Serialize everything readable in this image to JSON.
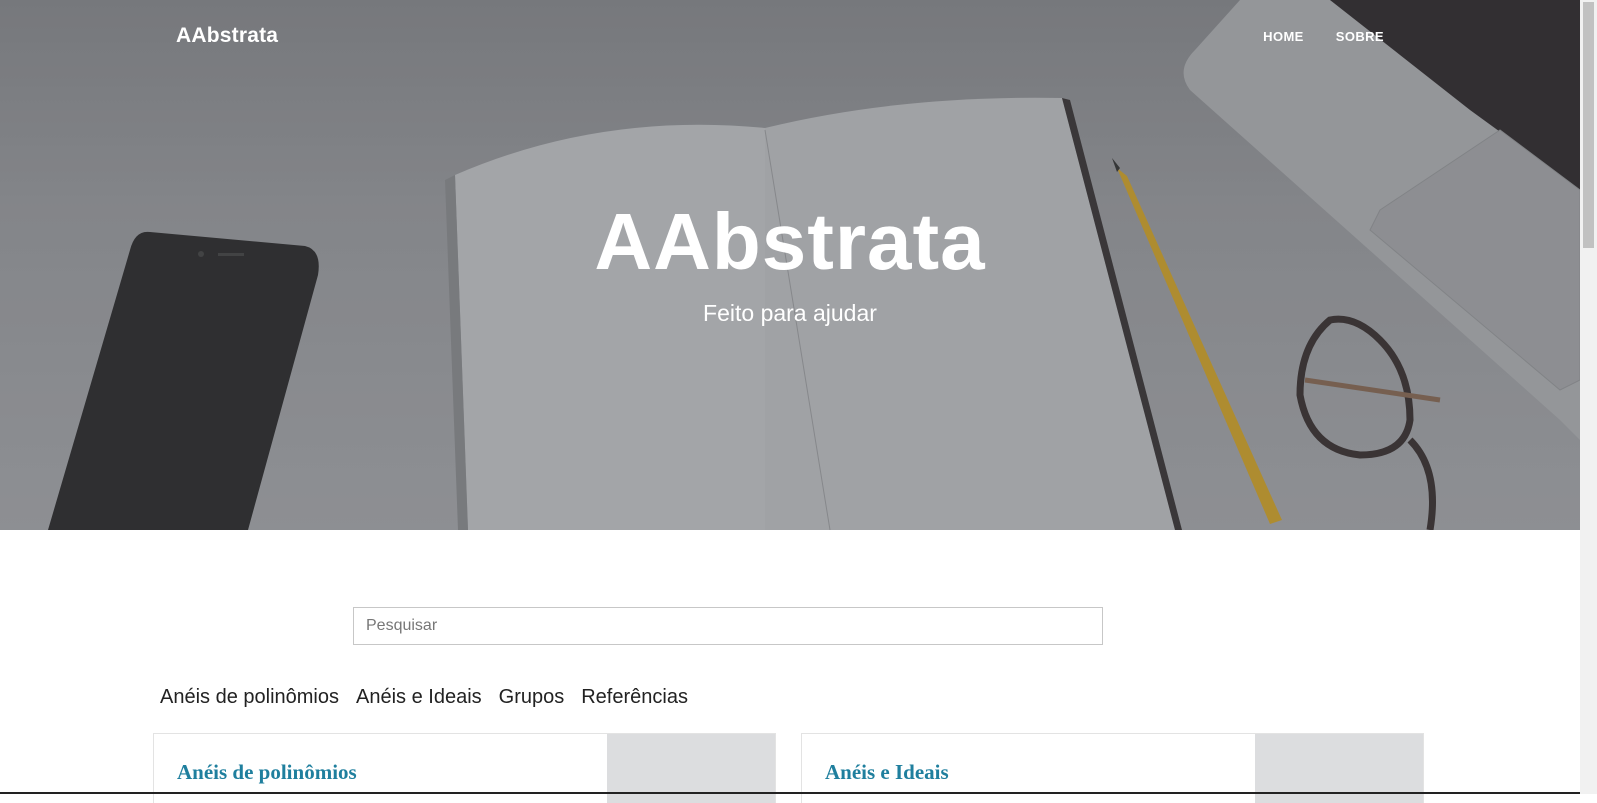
{
  "header": {
    "brand": "AAbstrata",
    "nav": [
      {
        "label": "HOME"
      },
      {
        "label": "SOBRE"
      }
    ]
  },
  "hero": {
    "title": "AAbstrata",
    "subtitle": "Feito para ajudar"
  },
  "search": {
    "placeholder": "Pesquisar",
    "value": ""
  },
  "categories": [
    {
      "label": "Anéis de polinômios"
    },
    {
      "label": "Anéis e Ideais"
    },
    {
      "label": "Grupos"
    },
    {
      "label": "Referências"
    }
  ],
  "cards": [
    {
      "title": "Anéis de polinômios"
    },
    {
      "title": "Anéis e Ideais"
    }
  ],
  "colors": {
    "card_title": "#1f7f9e",
    "hero_overlay": "#6e6f74",
    "text_dark": "#222222"
  }
}
